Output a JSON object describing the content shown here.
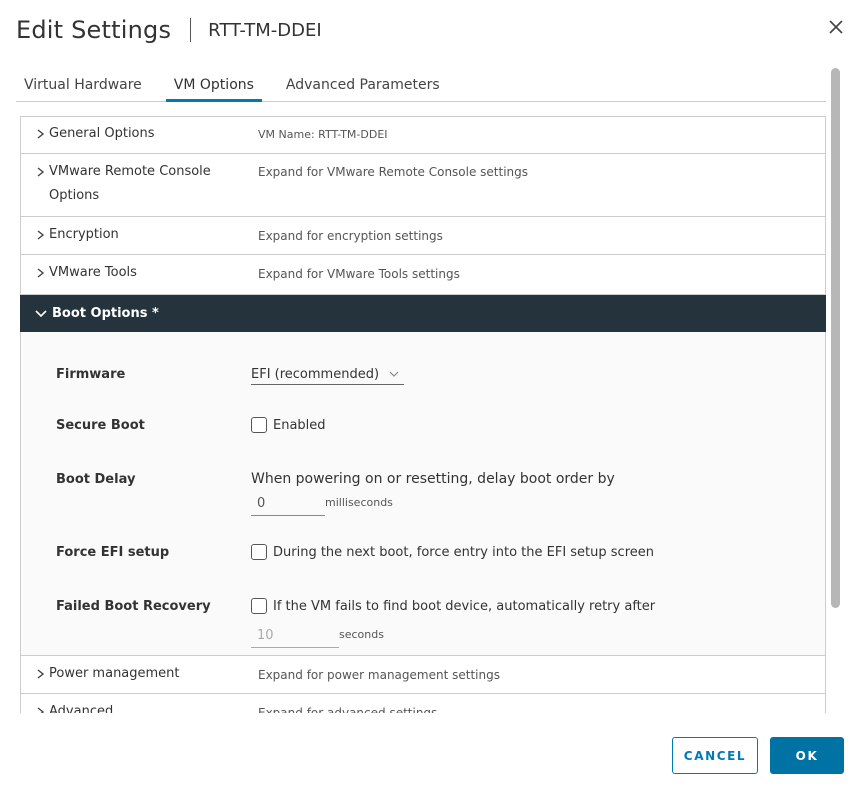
{
  "dialog": {
    "title": "Edit Settings",
    "vm_name": "RTT-TM-DDEI",
    "close_icon": "close-icon"
  },
  "tabs": [
    {
      "label": "Virtual Hardware",
      "active": false
    },
    {
      "label": "VM Options",
      "active": true
    },
    {
      "label": "Advanced Parameters",
      "active": false
    }
  ],
  "sections": {
    "general": {
      "label": "General Options",
      "value": "VM Name: RTT-TM-DDEI"
    },
    "remote_console": {
      "label_line1": "VMware Remote Console",
      "label_line2": "Options",
      "value": "Expand for VMware Remote Console settings"
    },
    "encryption": {
      "label": "Encryption",
      "value": "Expand for encryption settings"
    },
    "vmware_tools": {
      "label": "VMware Tools",
      "value": "Expand for VMware Tools settings"
    },
    "boot_options": {
      "label": "Boot Options *",
      "expanded": true
    },
    "power_management": {
      "label": "Power management",
      "value": "Expand for power management settings"
    },
    "advanced": {
      "label": "Advanced",
      "value": "Expand for advanced settings"
    }
  },
  "boot": {
    "firmware": {
      "label": "Firmware",
      "selected": "EFI (recommended)"
    },
    "secure_boot": {
      "label": "Secure Boot",
      "checkbox_label": "Enabled",
      "checked": false
    },
    "boot_delay": {
      "label": "Boot Delay",
      "description": "When powering on or resetting, delay boot order by",
      "value": "0",
      "unit": "milliseconds"
    },
    "force_efi": {
      "label": "Force EFI setup",
      "checkbox_label": "During the next boot, force entry into the EFI setup screen",
      "checked": false
    },
    "failed_recovery": {
      "label": "Failed Boot Recovery",
      "checkbox_label": "If the VM fails to find boot device, automatically retry after",
      "checked": false,
      "value": "10",
      "unit": "seconds"
    }
  },
  "footer": {
    "cancel_label": "CANCEL",
    "ok_label": "OK"
  },
  "colors": {
    "accent": "#0079b8",
    "header_dark": "#25333d",
    "ok_button": "#0072a3"
  }
}
